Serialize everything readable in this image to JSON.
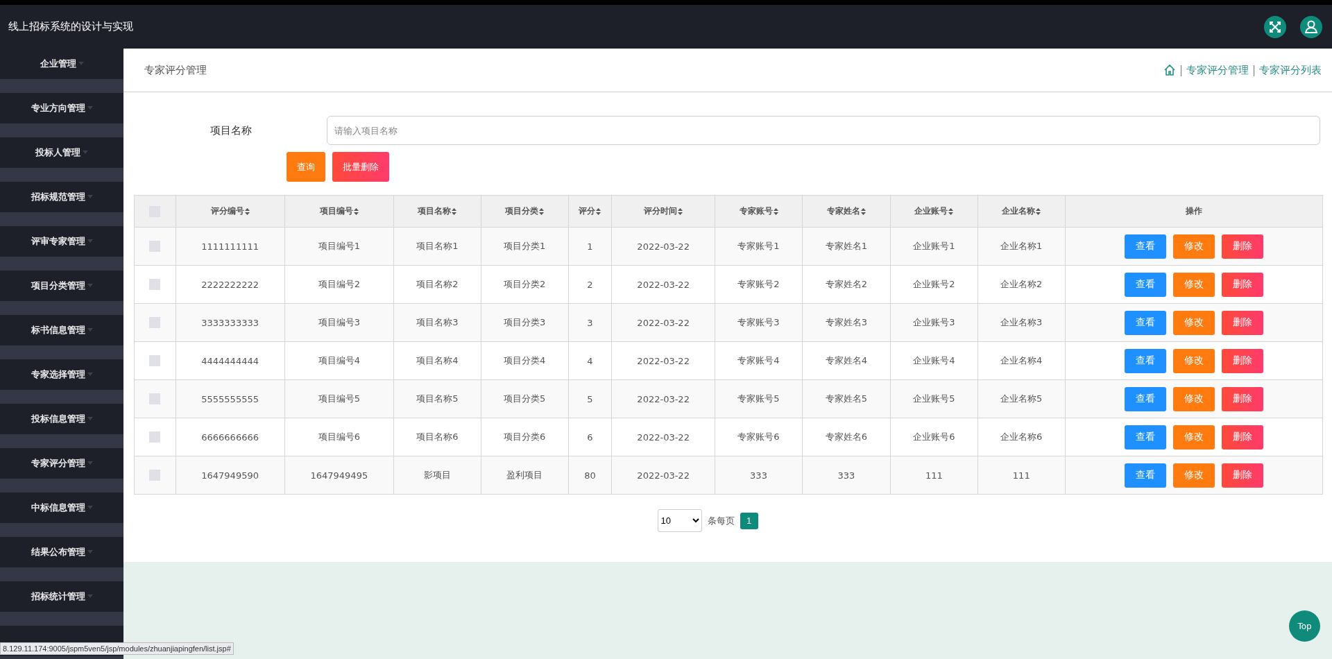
{
  "header": {
    "title": "线上招标系统的设计与实现"
  },
  "sidebar": {
    "items": [
      {
        "label": "企业管理"
      },
      {
        "label": "专业方向管理"
      },
      {
        "label": "投标人管理"
      },
      {
        "label": "招标规范管理"
      },
      {
        "label": "评审专家管理"
      },
      {
        "label": "项目分类管理"
      },
      {
        "label": "标书信息管理"
      },
      {
        "label": "专家选择管理"
      },
      {
        "label": "投标信息管理"
      },
      {
        "label": "专家评分管理"
      },
      {
        "label": "中标信息管理"
      },
      {
        "label": "结果公布管理"
      },
      {
        "label": "招标统计管理"
      }
    ]
  },
  "page_title": "专家评分管理",
  "breadcrumb": [
    {
      "separator": "|",
      "label": "专家评分管理"
    },
    {
      "separator": "|",
      "label": "专家评分列表"
    }
  ],
  "search": {
    "label": "项目名称",
    "placeholder": "请输入项目名称",
    "buttons": [
      {
        "label": "查询",
        "kind": "query"
      },
      {
        "label": "批量删除",
        "kind": "batch-delete"
      }
    ]
  },
  "table": {
    "select_all": {
      "checked": false
    },
    "columns": [
      {
        "label": "评分编号",
        "sortable": true
      },
      {
        "label": "项目编号",
        "sortable": true
      },
      {
        "label": "项目名称",
        "sortable": true
      },
      {
        "label": "项目分类",
        "sortable": true
      },
      {
        "label": "评分",
        "sortable": true
      },
      {
        "label": "评分时间",
        "sortable": true
      },
      {
        "label": "专家账号",
        "sortable": true
      },
      {
        "label": "专家姓名",
        "sortable": true
      },
      {
        "label": "企业账号",
        "sortable": true
      },
      {
        "label": "企业名称",
        "sortable": true
      },
      {
        "label": "操作",
        "sortable": false
      }
    ],
    "rows": [
      {
        "checked": false,
        "cells": [
          "1111111111",
          "项目编号1",
          "项目名称1",
          "项目分类1",
          "1",
          "2022-03-22",
          "专家账号1",
          "专家姓名1",
          "企业账号1",
          "企业名称1"
        ],
        "actions": [
          {
            "label": "查看",
            "kind": "view"
          },
          {
            "label": "修改",
            "kind": "edit"
          },
          {
            "label": "删除",
            "kind": "delete"
          }
        ]
      },
      {
        "checked": false,
        "cells": [
          "2222222222",
          "项目编号2",
          "项目名称2",
          "项目分类2",
          "2",
          "2022-03-22",
          "专家账号2",
          "专家姓名2",
          "企业账号2",
          "企业名称2"
        ],
        "actions": [
          {
            "label": "查看",
            "kind": "view"
          },
          {
            "label": "修改",
            "kind": "edit"
          },
          {
            "label": "删除",
            "kind": "delete"
          }
        ]
      },
      {
        "checked": false,
        "cells": [
          "3333333333",
          "项目编号3",
          "项目名称3",
          "项目分类3",
          "3",
          "2022-03-22",
          "专家账号3",
          "专家姓名3",
          "企业账号3",
          "企业名称3"
        ],
        "actions": [
          {
            "label": "查看",
            "kind": "view"
          },
          {
            "label": "修改",
            "kind": "edit"
          },
          {
            "label": "删除",
            "kind": "delete"
          }
        ]
      },
      {
        "checked": false,
        "cells": [
          "4444444444",
          "项目编号4",
          "项目名称4",
          "项目分类4",
          "4",
          "2022-03-22",
          "专家账号4",
          "专家姓名4",
          "企业账号4",
          "企业名称4"
        ],
        "actions": [
          {
            "label": "查看",
            "kind": "view"
          },
          {
            "label": "修改",
            "kind": "edit"
          },
          {
            "label": "删除",
            "kind": "delete"
          }
        ]
      },
      {
        "checked": false,
        "cells": [
          "5555555555",
          "项目编号5",
          "项目名称5",
          "项目分类5",
          "5",
          "2022-03-22",
          "专家账号5",
          "专家姓名5",
          "企业账号5",
          "企业名称5"
        ],
        "actions": [
          {
            "label": "查看",
            "kind": "view"
          },
          {
            "label": "修改",
            "kind": "edit"
          },
          {
            "label": "删除",
            "kind": "delete"
          }
        ]
      },
      {
        "checked": false,
        "cells": [
          "6666666666",
          "项目编号6",
          "项目名称6",
          "项目分类6",
          "6",
          "2022-03-22",
          "专家账号6",
          "专家姓名6",
          "企业账号6",
          "企业名称6"
        ],
        "actions": [
          {
            "label": "查看",
            "kind": "view"
          },
          {
            "label": "修改",
            "kind": "edit"
          },
          {
            "label": "删除",
            "kind": "delete"
          }
        ]
      },
      {
        "checked": false,
        "cells": [
          "1647949590",
          "1647949495",
          "影项目",
          "盈利项目",
          "80",
          "2022-03-22",
          "333",
          "333",
          "111",
          "111"
        ],
        "actions": [
          {
            "label": "查看",
            "kind": "view"
          },
          {
            "label": "修改",
            "kind": "edit"
          },
          {
            "label": "删除",
            "kind": "delete"
          }
        ]
      }
    ]
  },
  "pagination": {
    "page_size": "10",
    "per_page_label": "条每页",
    "pages": [
      {
        "label": "1",
        "selected": true
      }
    ]
  },
  "top_button": "Top",
  "status_url": "8.129.11.174:9005/jspm5ven5/jsp/modules/zhuanjiapingfen/list.jsp#"
}
